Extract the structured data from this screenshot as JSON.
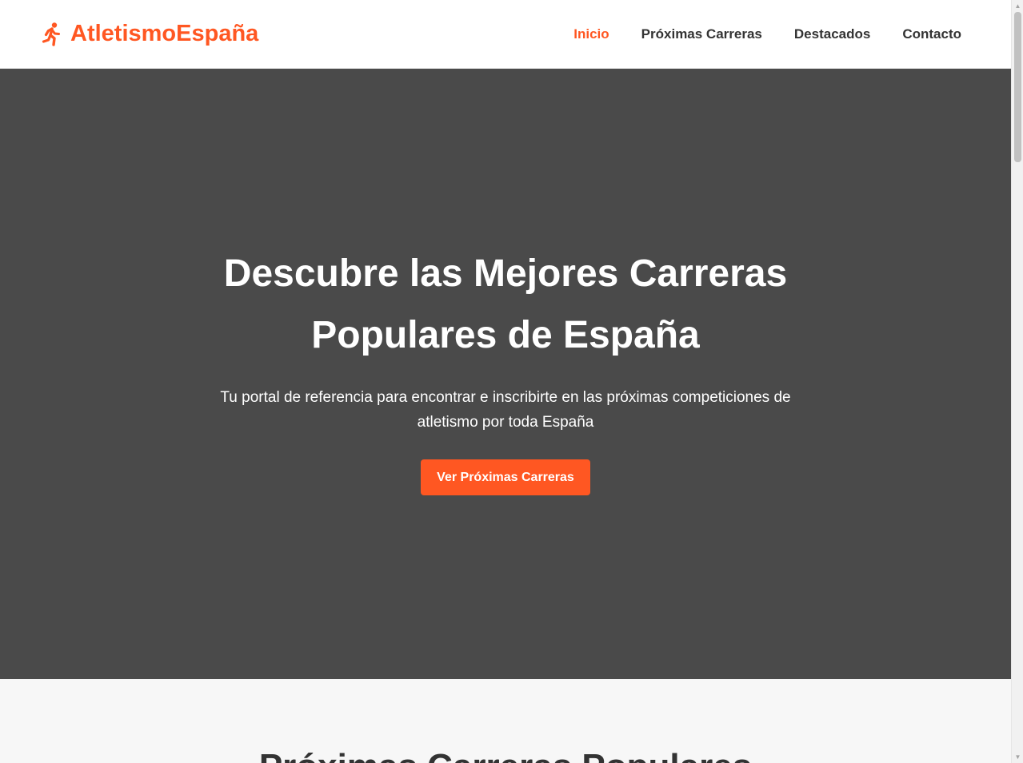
{
  "brand": {
    "name": "AtletismoEspaña",
    "icon": "running-person-icon",
    "color": "#ff5722"
  },
  "nav": {
    "items": [
      {
        "label": "Inicio",
        "active": true
      },
      {
        "label": "Próximas Carreras",
        "active": false
      },
      {
        "label": "Destacados",
        "active": false
      },
      {
        "label": "Contacto",
        "active": false
      }
    ]
  },
  "hero": {
    "title": "Descubre las Mejores Carreras Populares de España",
    "subtitle": "Tu portal de referencia para encontrar e inscribirte en las próximas competiciones de atletismo por toda España",
    "cta_label": "Ver Próximas Carreras",
    "background": "#4a4a4a"
  },
  "section": {
    "title": "Próximas Carreras Populares"
  },
  "colors": {
    "accent": "#ff5722",
    "text": "#333333",
    "section_bg": "#f7f7f7"
  }
}
